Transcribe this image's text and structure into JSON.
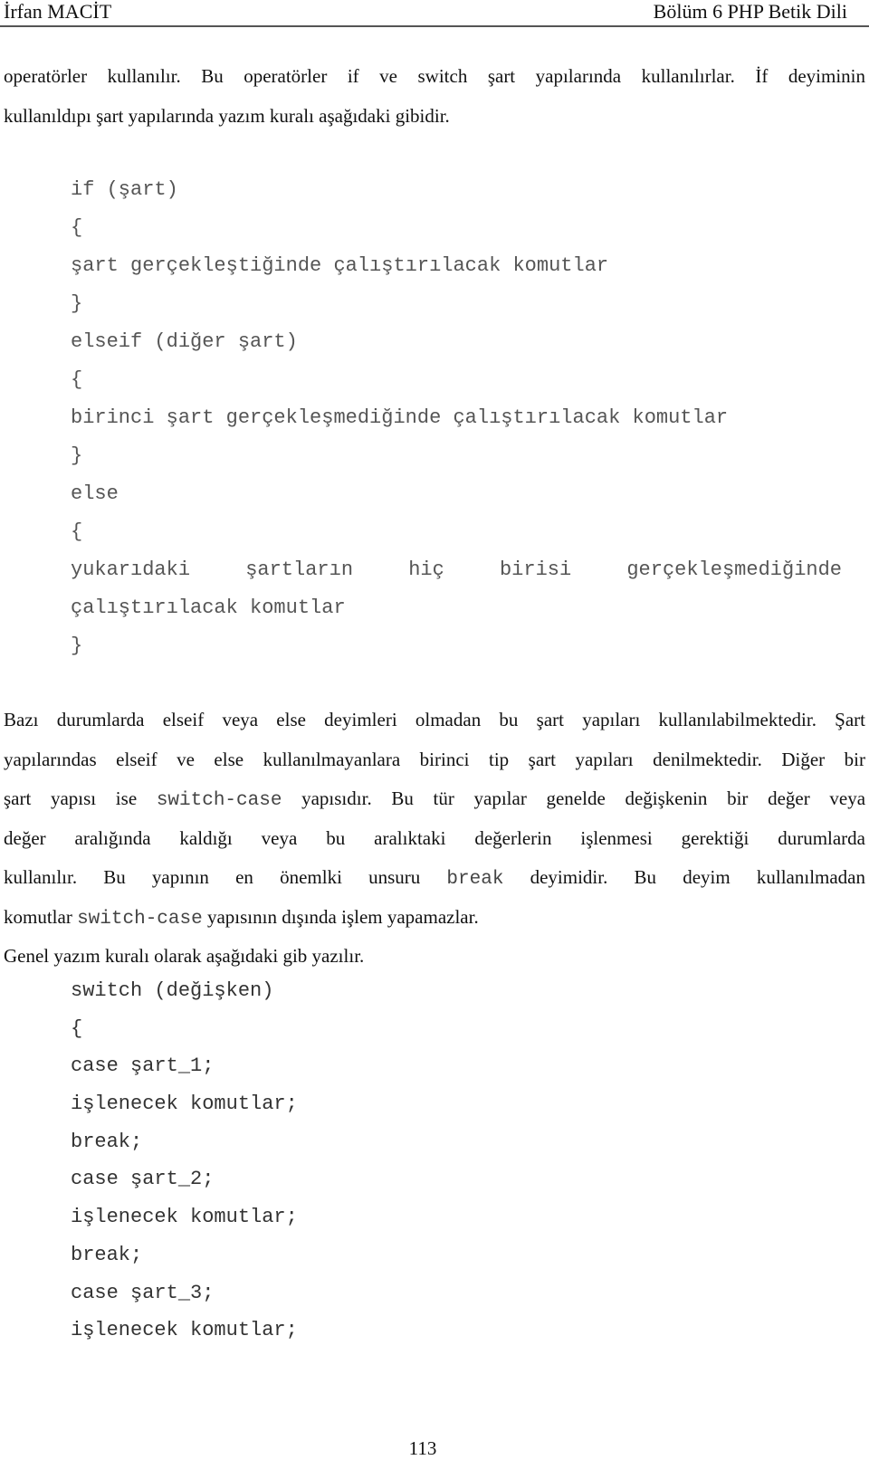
{
  "header": {
    "author": "İrfan MACİT",
    "chapter": "Bölüm 6 PHP Betik Dili"
  },
  "intro": {
    "line1": "operatörler kullanılır. Bu operatörler if ve switch şart yapılarında kullanılırlar. İf deyiminin",
    "line2": "kullanıldıpı şart yapılarında yazım kuralı aşağıdaki gibidir."
  },
  "if_code": [
    "if (şart)",
    "{",
    "şart gerçekleştiğinde çalıştırılacak komutlar",
    "}",
    "elseif (diğer şart)",
    "{",
    "birinci şart gerçekleşmediğinde çalıştırılacak komutlar",
    "}",
    "else",
    "{",
    "yukarıdaki şartların hiç birisi gerçekleşmediğinde",
    "çalıştırılacak komutlar",
    "}"
  ],
  "body": {
    "l1": "Bazı durumlarda elseif veya else deyimleri olmadan bu şart yapıları kullanılabilmektedir. Şart",
    "l2": "yapılarındas elseif ve else kullanılmayanlara birinci tip şart yapıları denilmektedir. Diğer bir",
    "l3_a": "şart yapısı ise",
    "l3_code": "switch-case",
    "l3_b": "yapısıdır. Bu tür yapılar genelde değişkenin bir değer veya",
    "l4": "değer aralığında kaldığı veya bu aralıktaki değerlerin işlenmesi gerektiği durumlarda",
    "l5_a": "kullanılır. Bu yapının en önemlki unsuru",
    "l5_code": "break",
    "l5_b": "deyimidir. Bu deyim kullanılmadan",
    "l6_a": "komutlar",
    "l6_code": "switch-case",
    "l6_b": "yapısının dışında işlem yapamazlar.",
    "l7": "Genel yazım kuralı olarak aşağıdaki gib yazılır."
  },
  "switch_code": [
    "switch (değişken)",
    "{",
    "case şart_1;",
    "işlenecek komutlar;",
    "break;",
    "case şart_2;",
    "işlenecek komutlar;",
    "break;",
    "case şart_3;",
    "işlenecek komutlar;"
  ],
  "footer": {
    "page_number": "113"
  }
}
